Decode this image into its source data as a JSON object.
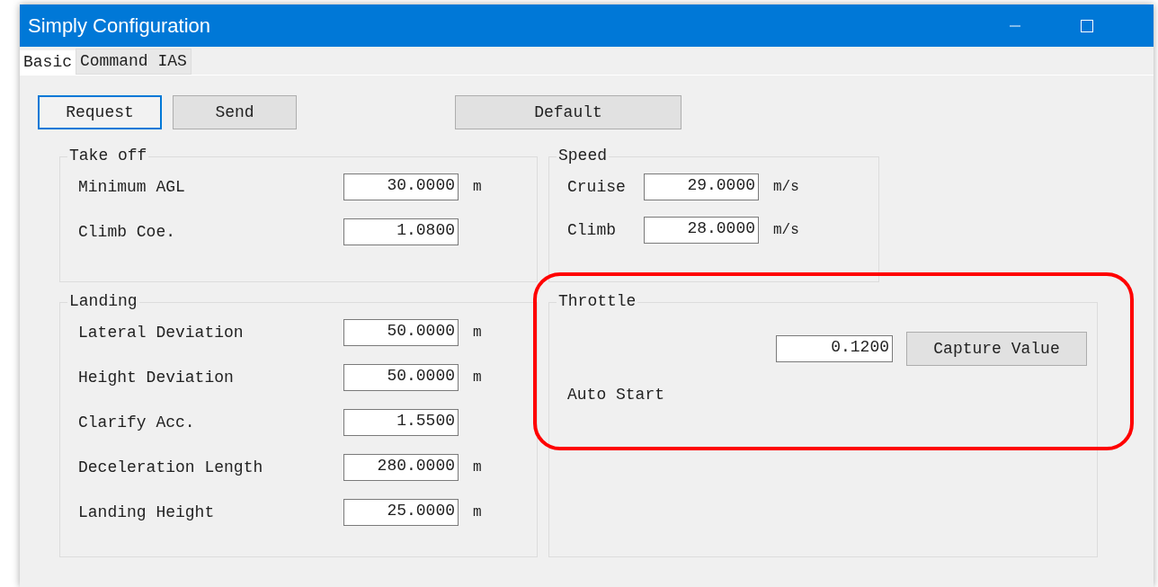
{
  "window": {
    "title": "Simply Configuration"
  },
  "tabs": [
    {
      "label": "Basic",
      "selected": true
    },
    {
      "label": "Command IAS",
      "selected": false
    }
  ],
  "toolbar": [
    {
      "label": "Request",
      "focused": true
    },
    {
      "label": "Send",
      "focused": false
    },
    {
      "label": "Default",
      "focused": false
    }
  ],
  "groups": [
    {
      "title": "Take off",
      "fields": [
        {
          "label": "Minimum AGL",
          "value": "30.0000",
          "unit": "m"
        },
        {
          "label": "Climb Coe.",
          "value": "1.0800"
        }
      ]
    },
    {
      "title": "Speed",
      "fields": [
        {
          "label": "Cruise",
          "value": "29.0000",
          "unit": "m/s"
        },
        {
          "label": "Climb",
          "value": "28.0000",
          "unit": "m/s"
        }
      ]
    },
    {
      "title": "Landing",
      "fields": [
        {
          "label": "Lateral Deviation",
          "value": "50.0000",
          "unit": "m"
        },
        {
          "label": "Height Deviation",
          "value": "50.0000",
          "unit": "m"
        },
        {
          "label": "Clarify Acc.",
          "value": "1.5500"
        },
        {
          "label": "Deceleration Length",
          "value": "280.0000",
          "unit": "m"
        },
        {
          "label": "Landing Height",
          "value": "25.0000",
          "unit": "m"
        }
      ]
    },
    {
      "title": "Throttle",
      "highlighted": true,
      "value": "0.1200",
      "button": "Capture Value",
      "label": "Auto Start"
    }
  ]
}
